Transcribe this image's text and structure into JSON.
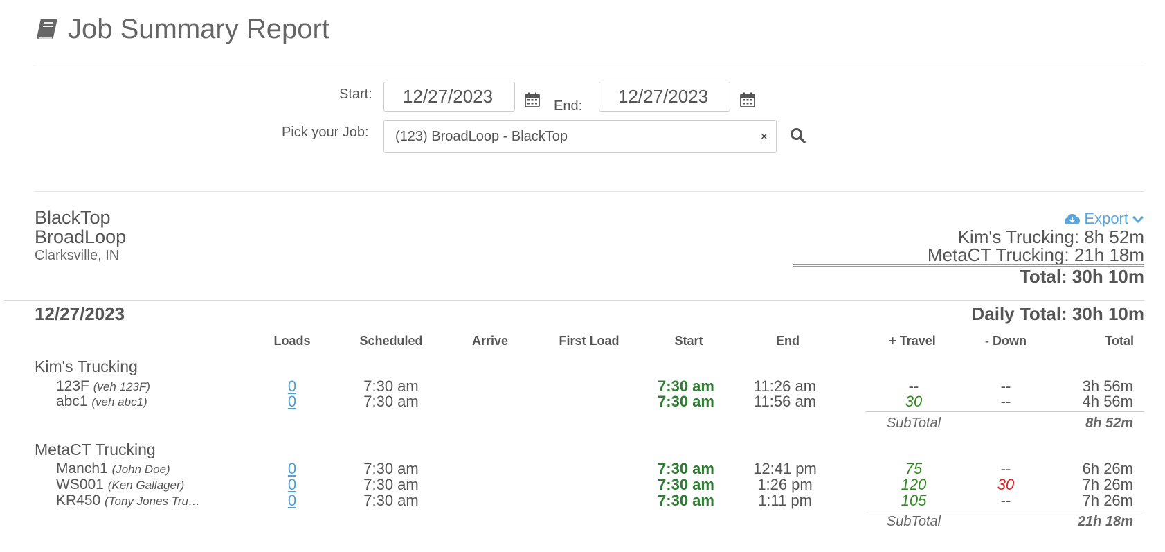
{
  "page": {
    "title": "Job Summary Report"
  },
  "filters": {
    "start_label": "Start:",
    "start_value": "12/27/2023",
    "end_label": "End:",
    "end_value": "12/27/2023",
    "job_label": "Pick your Job:",
    "job_value": "(123) BroadLoop - BlackTop",
    "clear_glyph": "×"
  },
  "job": {
    "name": "BlackTop",
    "location_name": "BroadLoop",
    "city": "Clarksville, IN"
  },
  "export": {
    "label": "Export"
  },
  "summary": {
    "lines": [
      {
        "text": "Kim's Trucking: 8h 52m"
      },
      {
        "text": "MetaCT Trucking: 21h 18m"
      }
    ],
    "total": "Total: 30h 10m"
  },
  "day": {
    "date": "12/27/2023",
    "daily_total": "Daily Total: 30h 10m",
    "columns": {
      "loads": "Loads",
      "scheduled": "Scheduled",
      "arrive": "Arrive",
      "first_load": "First Load",
      "start": "Start",
      "end": "End",
      "travel": "+ Travel",
      "down": "- Down",
      "total": "Total"
    },
    "groups": [
      {
        "name": "Kim's Trucking",
        "rows": [
          {
            "vehicle": "123F",
            "sub": "(veh 123F)",
            "loads": "0",
            "scheduled": "7:30 am",
            "start": "7:30 am",
            "end": "11:26 am",
            "travel": "--",
            "down": "--",
            "total": "3h 56m"
          },
          {
            "vehicle": "abc1",
            "sub": "(veh abc1)",
            "loads": "0",
            "scheduled": "7:30 am",
            "start": "7:30 am",
            "end": "11:56 am",
            "travel": "30",
            "down": "--",
            "total": "4h 56m"
          }
        ],
        "subtotal_label": "SubTotal",
        "subtotal": "8h 52m"
      },
      {
        "name": "MetaCT Trucking",
        "rows": [
          {
            "vehicle": "Manch1",
            "sub": "(John Doe)",
            "loads": "0",
            "scheduled": "7:30 am",
            "start": "7:30 am",
            "end": "12:41 pm",
            "travel": "75",
            "down": "--",
            "total": "6h 26m"
          },
          {
            "vehicle": "WS001",
            "sub": "(Ken Gallager)",
            "loads": "0",
            "scheduled": "7:30 am",
            "start": "7:30 am",
            "end": "1:26 pm",
            "travel": "120",
            "down": "30",
            "total": "7h 26m"
          },
          {
            "vehicle": "KR450",
            "sub": "(Tony Jones Tru…",
            "loads": "0",
            "scheduled": "7:30 am",
            "start": "7:30 am",
            "end": "1:11 pm",
            "travel": "105",
            "down": "--",
            "total": "7h 26m"
          }
        ],
        "subtotal_label": "SubTotal",
        "subtotal": "21h 18m"
      }
    ]
  },
  "colors": {
    "accent_link": "#4a9fd8",
    "start_green": "#2e7d32",
    "travel_green": "#2e8b1e",
    "down_red": "#e02020"
  }
}
